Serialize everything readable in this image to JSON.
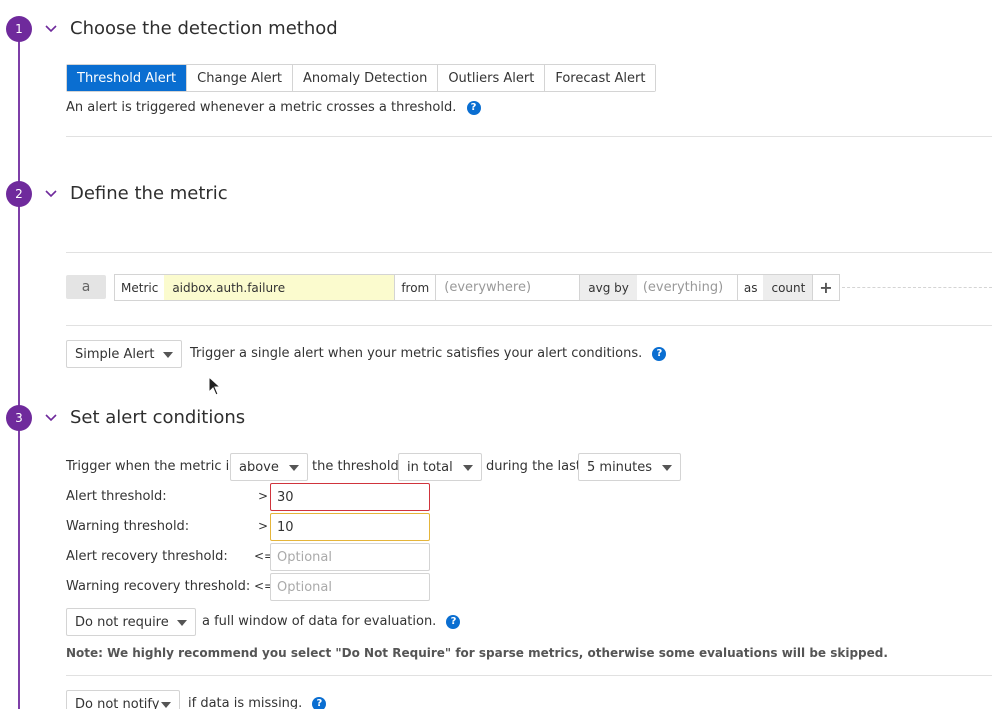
{
  "sections": [
    {
      "number": "1",
      "title": "Choose the detection method"
    },
    {
      "number": "2",
      "title": "Define the metric"
    },
    {
      "number": "3",
      "title": "Set alert conditions"
    }
  ],
  "detection": {
    "methods": [
      "Threshold Alert",
      "Change Alert",
      "Anomaly Detection",
      "Outliers Alert",
      "Forecast Alert"
    ],
    "active": "Threshold Alert",
    "description": "An alert is triggered whenever a metric crosses a threshold."
  },
  "query": {
    "letter": "a",
    "metric_label": "Metric",
    "metric_value": "aidbox.auth.failure",
    "from_label": "from",
    "from_placeholder": "(everywhere)",
    "avg_by_label": "avg by",
    "avg_by_placeholder": "(everything)",
    "as_label": "as",
    "as_value": "count",
    "add_symbol": "+"
  },
  "alert_type": {
    "selected": "Simple Alert",
    "description": "Trigger a single alert when your metric satisfies your alert conditions."
  },
  "conditions": {
    "trigger_prefix": "Trigger when the metric is",
    "comparison": "above",
    "threshold_text": "the threshold",
    "aggregation": "in total",
    "during_text": "during the last",
    "window": "5 minutes",
    "alert_threshold_label": "Alert threshold:",
    "alert_threshold_op": ">",
    "alert_threshold_value": "30",
    "warning_threshold_label": "Warning threshold:",
    "warning_threshold_op": ">",
    "warning_threshold_value": "10",
    "alert_recovery_label": "Alert recovery threshold:",
    "alert_recovery_op": "<=",
    "alert_recovery_placeholder": "Optional",
    "warning_recovery_label": "Warning recovery threshold:",
    "warning_recovery_op": "<=",
    "warning_recovery_placeholder": "Optional",
    "require_window": "Do not require",
    "require_window_text": "a full window of data for evaluation.",
    "note": "Note: We highly recommend you select \"Do Not Require\" for sparse metrics, otherwise some evaluations will be skipped.",
    "missing_data": "Do not notify",
    "missing_data_text": "if data is missing."
  },
  "help_symbol": "?",
  "colors": {
    "accent": "#0a6ed1",
    "step": "#6f2a9c",
    "alert_border": "#d0343c",
    "warning_border": "#e5b53a",
    "metric_highlight": "#fbfbce"
  }
}
